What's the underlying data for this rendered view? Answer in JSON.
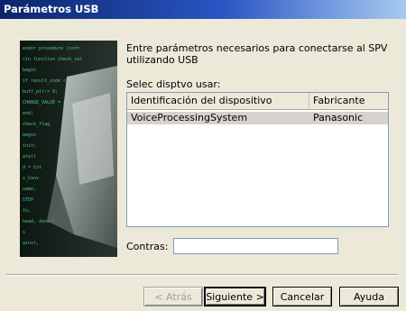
{
  "window": {
    "title": "Parámetros USB"
  },
  "intro": {
    "text": "Entre parámetros necesarios para conectarse al SPV utilizando USB"
  },
  "device_select": {
    "label": "Selec disptvo usar:",
    "columns": [
      "Identificación del dispositivo",
      "Fabricante"
    ],
    "rows": [
      {
        "device": "VoiceProcessingSystem",
        "maker": "Panasonic",
        "selected": true
      }
    ]
  },
  "password": {
    "label": "Contras:",
    "value": ""
  },
  "buttons": {
    "back": "< Atrás",
    "next": "Siguiente >",
    "cancel": "Cancelar",
    "help": "Ayuda"
  },
  "side_image": {
    "code_lines": [
      "endor procedure (cont ",
      "rin function check_val",
      "begin",
      "  if result_code < 0",
      "   buff_ptr:= 0;",
      "  CHANGE_VALUE = $",
      "end;",
      "  check_flag",
      "begin",
      "  init;",
      "aterl",
      "d = Cnt",
      "s_Conv",
      "  name,",
      "STEP",
      " fo,",
      "head, doneof,",
      "  s",
      "ainst,"
    ]
  }
}
